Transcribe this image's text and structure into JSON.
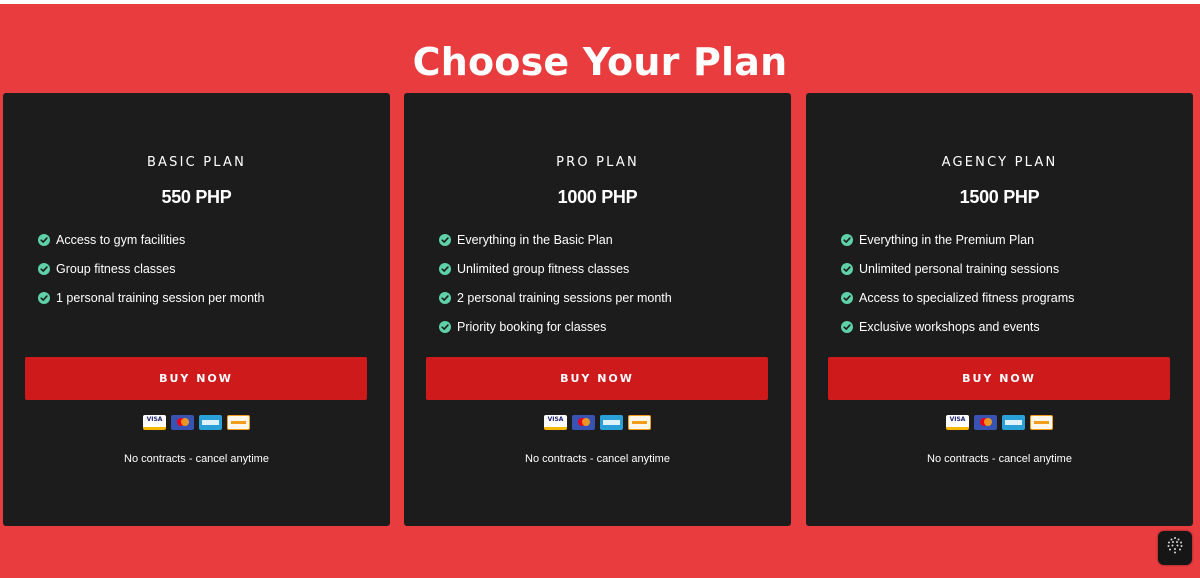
{
  "page": {
    "title": "Choose Your Plan",
    "background_color": "#e83c3e",
    "card_color": "#1c1c1d",
    "button_color": "#cf1a1c",
    "check_color": "#5fd1a8"
  },
  "plans": [
    {
      "name": "BASIC PLAN",
      "price": "550 PHP",
      "features": [
        "Access to gym facilities",
        "Group fitness classes",
        "1 personal training session per month"
      ],
      "button_label": "BUY NOW",
      "note": "No contracts - cancel anytime"
    },
    {
      "name": "PRO PLAN",
      "price": "1000 PHP",
      "features": [
        "Everything in the Basic Plan",
        "Unlimited group fitness classes",
        "2 personal training sessions per month",
        "Priority booking for classes"
      ],
      "button_label": "BUY NOW",
      "note": "No contracts - cancel anytime"
    },
    {
      "name": "AGENCY PLAN",
      "price": "1500 PHP",
      "features": [
        "Everything in the Premium Plan",
        "Unlimited personal training sessions",
        "Access to specialized fitness programs",
        "Exclusive workshops and events"
      ],
      "button_label": "BUY NOW",
      "note": "No contracts - cancel anytime"
    }
  ],
  "payment_icons": [
    "visa-icon",
    "mastercard-icon",
    "amex-icon",
    "discover-icon"
  ],
  "corner_badge_icon": "dotted-sphere-icon"
}
